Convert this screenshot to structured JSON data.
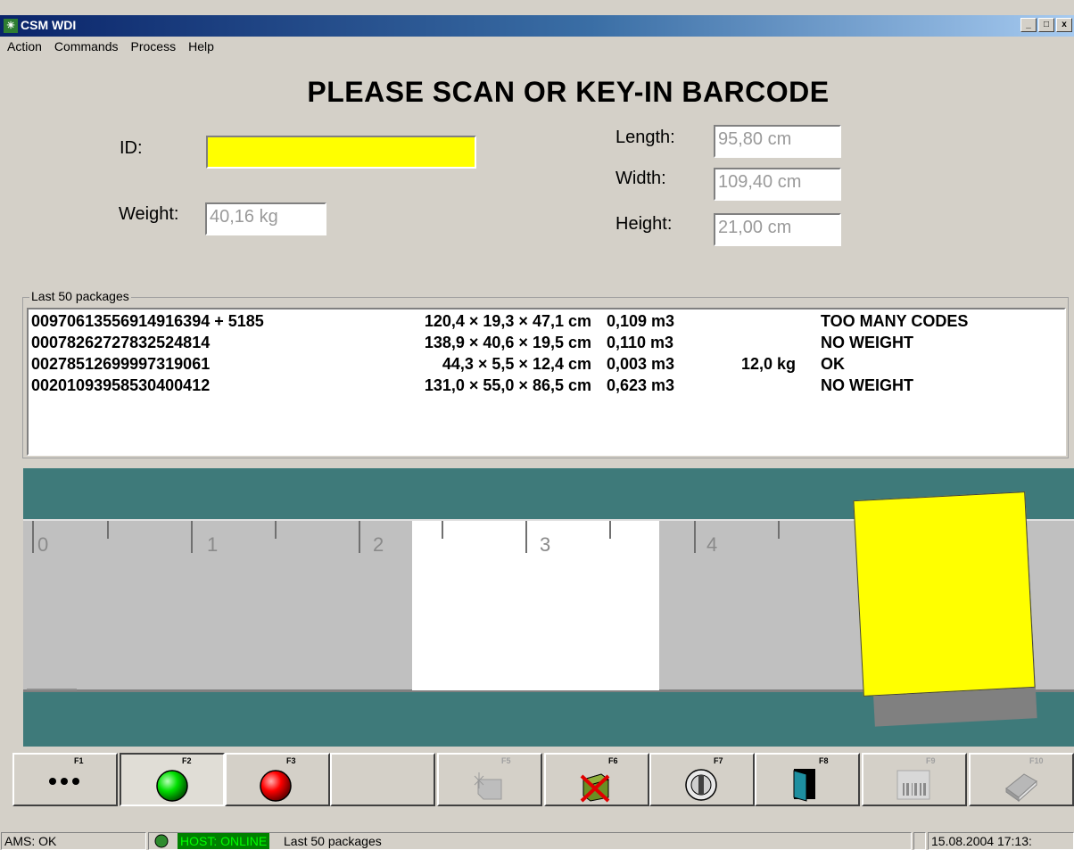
{
  "window": {
    "title": "CSM WDI",
    "controls": [
      "_",
      "□",
      "x"
    ]
  },
  "menu": {
    "items": [
      "Action",
      "Commands",
      "Process",
      "Help"
    ]
  },
  "headline": "PLEASE SCAN OR KEY-IN BARCODE",
  "form": {
    "id_label": "ID:",
    "id_value": "",
    "weight_label": "Weight:",
    "weight_value": "40,16 kg",
    "length_label": "Length:",
    "length_value": "95,80 cm",
    "width_label": "Width:",
    "width_value": "109,40 cm",
    "height_label": "Height:",
    "height_value": "21,00 cm"
  },
  "packages": {
    "group_label": "Last 50 packages",
    "rows": [
      {
        "code": "00970613556914916394 + 5185",
        "dims": "120,4 × 19,3 × 47,1 cm",
        "volume": "0,109 m3",
        "weight": "",
        "status": "TOO MANY CODES"
      },
      {
        "code": "00078262727832524814",
        "dims": "138,9 × 40,6 × 19,5 cm",
        "volume": "0,110 m3",
        "weight": "",
        "status": "NO WEIGHT"
      },
      {
        "code": "00278512699997319061",
        "dims": "44,3 × 5,5 × 12,4 cm",
        "volume": "0,003 m3",
        "weight": "12,0 kg",
        "status": "OK"
      },
      {
        "code": "00201093958530400412",
        "dims": "131,0 × 55,0 × 86,5 cm",
        "volume": "0,623 m3",
        "weight": "",
        "status": "NO WEIGHT"
      }
    ]
  },
  "conveyor": {
    "scale_labels": [
      "0",
      "1",
      "2",
      "3",
      "4"
    ]
  },
  "toolbar": {
    "keys": [
      "F1",
      "F2",
      "F3",
      "",
      "F5",
      "F6",
      "F7",
      "F8",
      "F9",
      "F10"
    ]
  },
  "status": {
    "ams": "AMS: OK",
    "host": "HOST: ONLINE",
    "message": "Last 50 packages",
    "datetime": "15.08.2004 17:13:"
  },
  "colors": {
    "accent": "#ffff00",
    "conveyor": "#3e7a7a",
    "online": "#008000"
  }
}
